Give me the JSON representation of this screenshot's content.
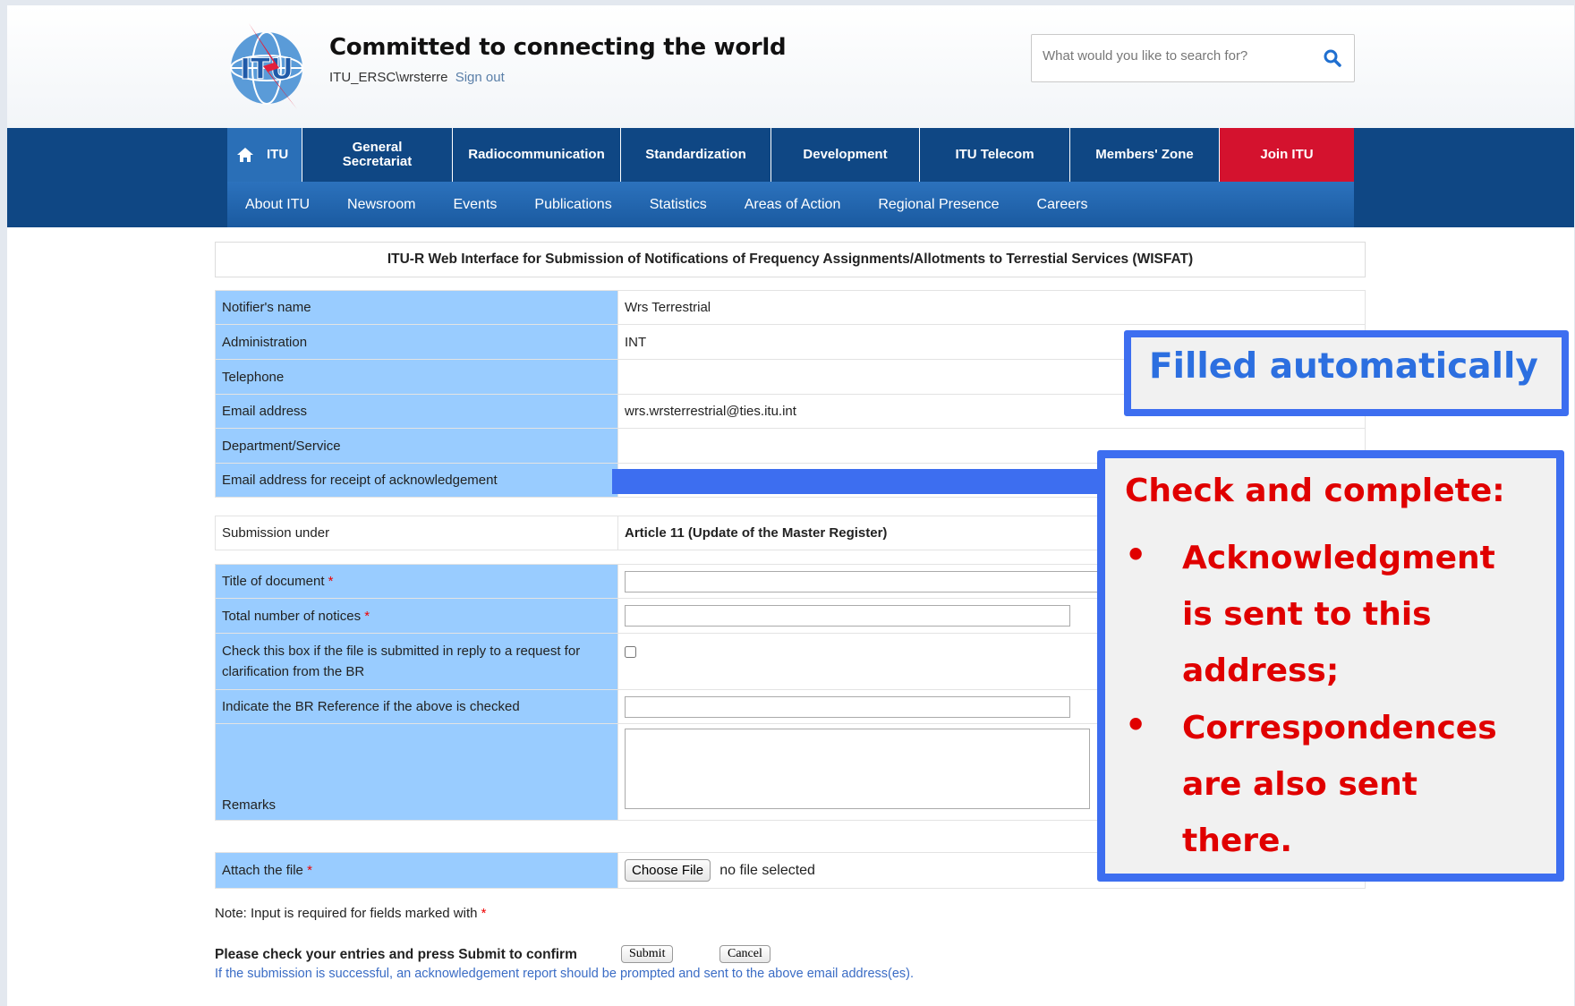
{
  "header": {
    "tagline": "Committed to connecting the world",
    "user": "ITU_ERSC\\wrsterre",
    "signout": "Sign out",
    "search_placeholder": "What would you like to search for?",
    "logo_text": "ITU"
  },
  "nav": {
    "main": [
      "ITU",
      "General Secretariat",
      "Radiocommunication",
      "Standardization",
      "Development",
      "ITU Telecom",
      "Members' Zone",
      "Join ITU"
    ],
    "sub": [
      "About ITU",
      "Newsroom",
      "Events",
      "Publications",
      "Statistics",
      "Areas of Action",
      "Regional Presence",
      "Careers"
    ]
  },
  "form": {
    "title": "ITU-R Web Interface for Submission of Notifications of Frequency Assignments/Allotments to Terrestial Services (WISFAT)",
    "notifier_label": "Notifier's name",
    "notifier_value": "Wrs Terrestrial",
    "admin_label": "Administration",
    "admin_value": "INT",
    "phone_label": "Telephone",
    "phone_value": "",
    "email_label": "Email address",
    "email_value": "wrs.wrsterrestrial@ties.itu.int",
    "dept_label": "Department/Service",
    "dept_value": "",
    "ack_label": "Email address for receipt of acknowledgement",
    "submission_label": "Submission under",
    "submission_value": "Article 11 (Update of the Master Register)",
    "doc_title_label": "Title of document",
    "notices_label": "Total number of notices",
    "clarif_label": "Check this box if the file is submitted in reply to a request for clarification from the BR",
    "br_ref_label": "Indicate the BR Reference if the above is checked",
    "remarks_label": "Remarks",
    "attach_label": "Attach the file",
    "choose_file": "Choose File",
    "no_file": "no file selected",
    "required_mark": "*",
    "note": "Note: Input is required for fields marked with",
    "confirm": "Please check your entries and press Submit to confirm",
    "submit": "Submit",
    "cancel": "Cancel",
    "info": "If the submission is successful, an acknowledgement report should be prompted and sent to the above email address(es)."
  },
  "callouts": {
    "auto": "Filled automatically",
    "check_title": "Check and complete:",
    "bullet": "•",
    "b1_line1": "Acknowledgment",
    "b1_line2": "is sent to this",
    "b1_line3": "address;",
    "b2_line1": "Correspondences",
    "b2_line2": "are also sent",
    "b2_line3": "there."
  },
  "colors": {
    "nav_dark": "#0f4784",
    "join": "#d4122e",
    "label_bg": "#99ccff",
    "callout_border": "#3d6ef0",
    "callout_red": "#e00000"
  }
}
